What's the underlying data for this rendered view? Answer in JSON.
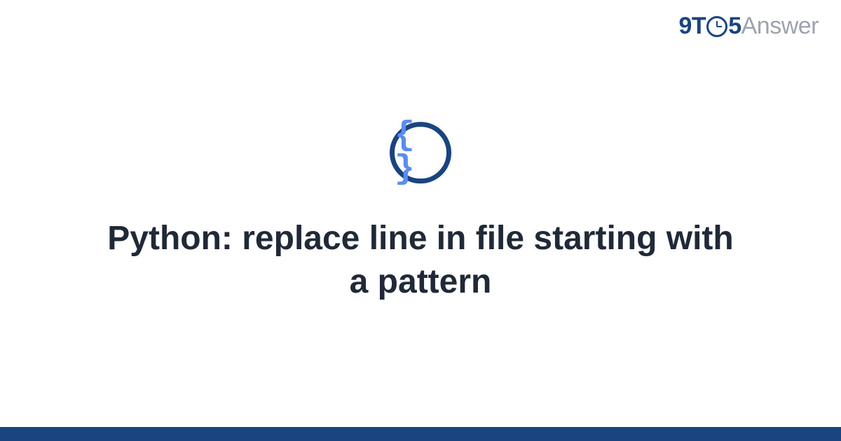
{
  "logo": {
    "prefix": "9T",
    "suffix": "5",
    "word": "Answer"
  },
  "icon": {
    "glyph": "{ }",
    "name": "code-braces"
  },
  "title": "Python: replace line in file starting with a pattern",
  "colors": {
    "brand_dark": "#1a4480",
    "brand_light": "#5b8def",
    "text": "#1f2937",
    "muted": "#9ca3af"
  }
}
